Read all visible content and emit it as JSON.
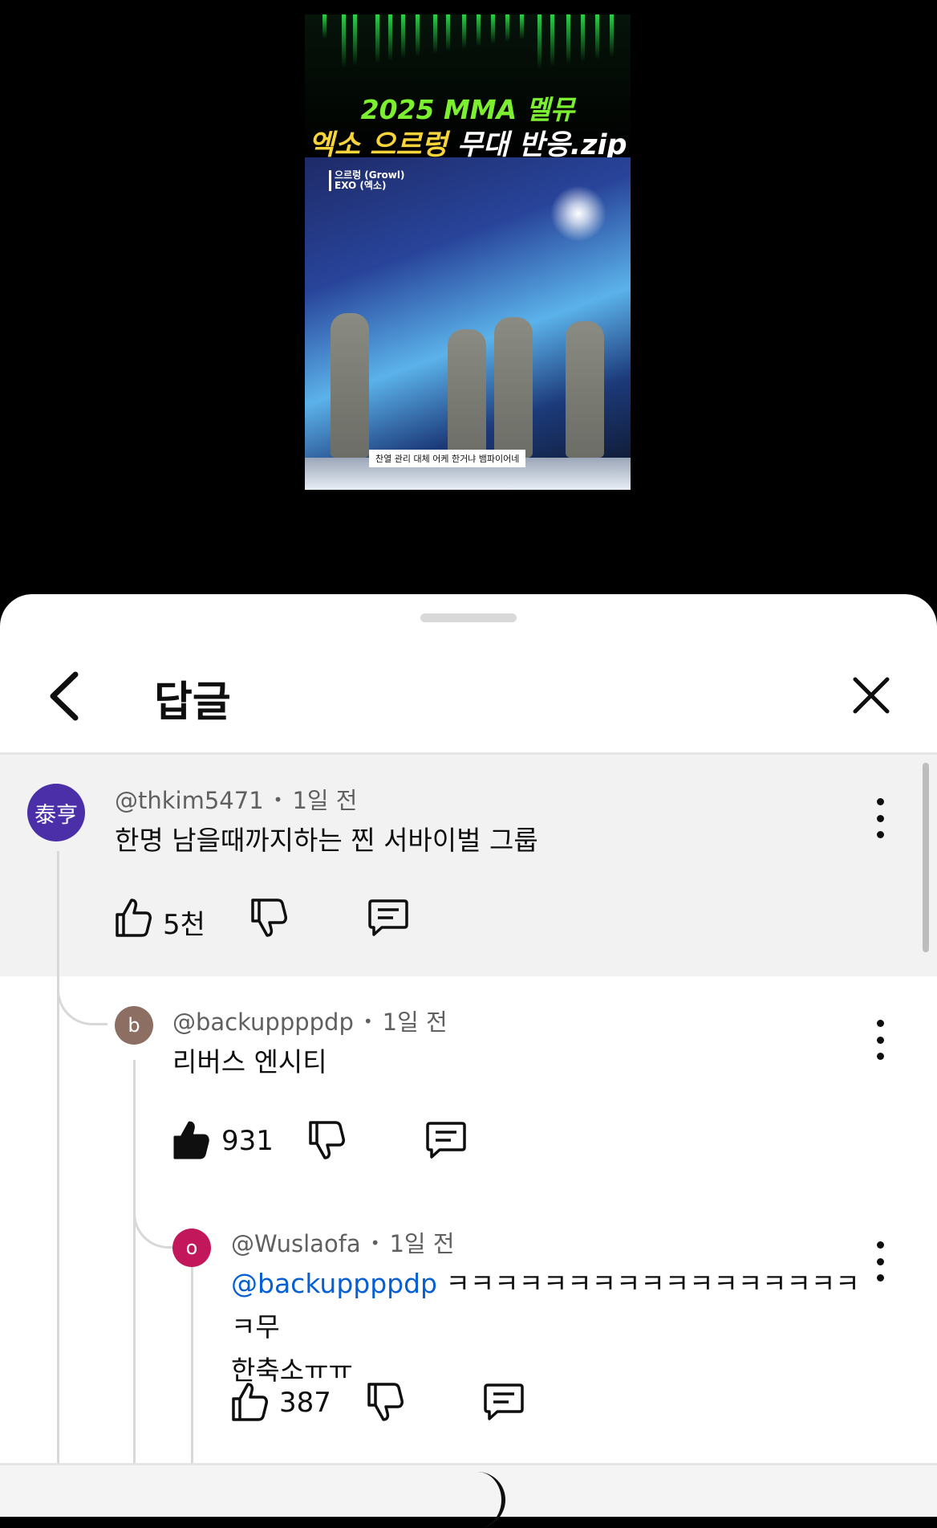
{
  "video": {
    "title_line1": "2025 MMA 멜뮤",
    "title_line2_highlight": "엑소 으르렁",
    "title_line2_rest": " 무대 반응.zip",
    "song_tag_line1": "으르렁 (Growl)",
    "song_tag_line2": "EXO (엑소)",
    "subtitle": "찬열 관리 대체 어케 한거냐 뱀파이어네"
  },
  "sheet": {
    "title": "답글"
  },
  "comments": [
    {
      "handle": "@thkim5471",
      "time": "1일 전",
      "avatar_text": "泰亨",
      "avatar_color": "#4a2fa8",
      "text": "한명 남을때까지하는 찐 서바이벌 그룹",
      "likes": "5천",
      "liked": false
    },
    {
      "handle": "@backuppppdp",
      "time": "1일 전",
      "avatar_text": "b",
      "avatar_color": "#8d6e63",
      "text": "리버스 엔시티",
      "likes": "931",
      "liked": true
    },
    {
      "handle": "@Wuslaofa",
      "time": "1일 전",
      "avatar_text": "o",
      "avatar_color": "#c2185b",
      "mention": "@backuppppdp",
      "text_after_mention": " ㅋㅋㅋㅋㅋㅋㅋㅋㅋㅋㅋㅋㅋㅋㅋㅋㅋㅋ무",
      "text_line2": "한축소ㅠㅠ",
      "likes": "387",
      "liked": false
    }
  ]
}
